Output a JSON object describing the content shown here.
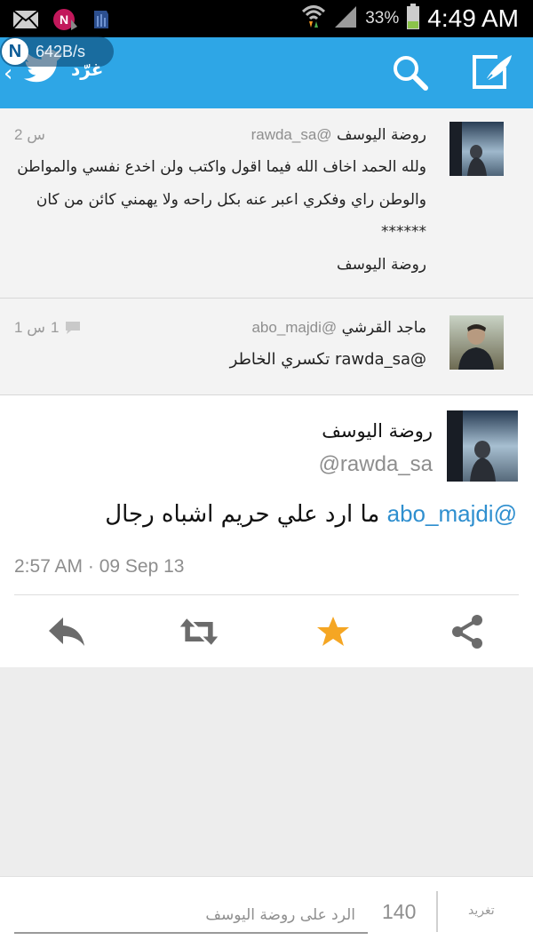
{
  "status_bar": {
    "battery_percent": "33%",
    "time": "4:49 AM",
    "icons": [
      "mail-icon",
      "n-app-icon",
      "sim-icon",
      "wifi-icon",
      "signal-icon",
      "battery-icon"
    ]
  },
  "network_speed": "642B/s",
  "app_bar": {
    "title": "غرّد",
    "color": "#2ea6e6",
    "icons": [
      "twitter-bird-icon",
      "search-icon",
      "compose-icon"
    ]
  },
  "timeline": [
    {
      "name": "روضة اليوسف",
      "handle": "@rawda_sa",
      "time": "2 س",
      "lines": [
        "ولله الحمد اخاف الله فيما اقول واكتب ولن اخدع نفسي والمواطن",
        "والوطن  راي وفكري اعبر عنه بكل راحه ولا يهمني كائن من كان",
        "******",
        "روضة اليوسف"
      ]
    },
    {
      "name": "ماجد القرشي",
      "handle": "@abo_majdi",
      "time": "1 س",
      "reply_count": "1",
      "text": "@rawda_sa تكسري الخاطر"
    }
  ],
  "detail": {
    "name": "روضة اليوسف",
    "handle": "@rawda_sa",
    "mention": "@abo_majdi",
    "text": "ما ارد علي حريم اشباه رجال",
    "timestamp": "2:57 AM · 09 Sep 13",
    "actions": [
      "reply",
      "retweet",
      "favorite",
      "share"
    ],
    "favorite_color": "#f5a623"
  },
  "composer": {
    "placeholder": "الرد على روضة اليوسف",
    "char_count": "140",
    "tweet_label": "تغريد"
  }
}
